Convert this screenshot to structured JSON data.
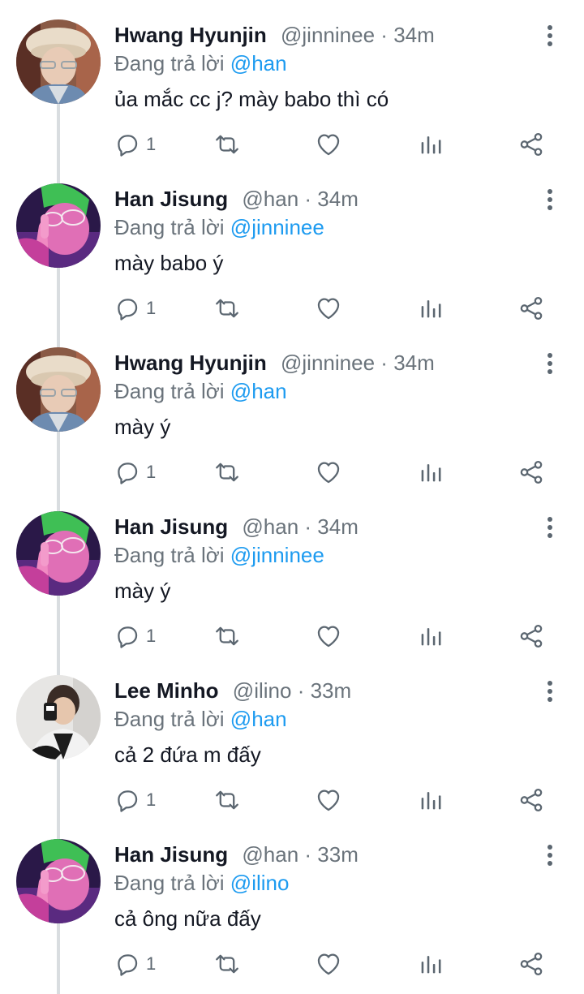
{
  "tweets": [
    {
      "display_name": "Hwang Hyunjin",
      "handle": "@jinninee",
      "separator": "·",
      "time": "34m",
      "reply_prefix": "Đang trả lời",
      "reply_to": "@han",
      "text": "ủa mắc cc j? mày babo thì có",
      "reply_count": "1",
      "avatar": "hyunjin-avatar"
    },
    {
      "display_name": "Han Jisung",
      "handle": "@han",
      "separator": "·",
      "time": "34m",
      "reply_prefix": "Đang trả lời",
      "reply_to": "@jinninee",
      "text": "mày babo ý",
      "reply_count": "1",
      "avatar": "jisung-avatar"
    },
    {
      "display_name": "Hwang Hyunjin",
      "handle": "@jinninee",
      "separator": "·",
      "time": "34m",
      "reply_prefix": "Đang trả lời",
      "reply_to": "@han",
      "text": "mày ý",
      "reply_count": "1",
      "avatar": "hyunjin-avatar"
    },
    {
      "display_name": "Han Jisung",
      "handle": "@han",
      "separator": "·",
      "time": "34m",
      "reply_prefix": "Đang trả lời",
      "reply_to": "@jinninee",
      "text": "mày ý",
      "reply_count": "1",
      "avatar": "jisung-avatar"
    },
    {
      "display_name": "Lee Minho",
      "handle": "@ilino",
      "separator": "·",
      "time": "33m",
      "reply_prefix": "Đang trả lời",
      "reply_to": "@han",
      "text": "cả 2 đứa m đấy",
      "reply_count": "1",
      "avatar": "minho-avatar"
    },
    {
      "display_name": "Han Jisung",
      "handle": "@han",
      "separator": "·",
      "time": "33m",
      "reply_prefix": "Đang trả lời",
      "reply_to": "@ilino",
      "text": "cả ông nữa đấy",
      "reply_count": "1",
      "avatar": "jisung-avatar"
    }
  ],
  "icons": {
    "reply": "reply-icon",
    "retweet": "retweet-icon",
    "like": "heart-icon",
    "analytics": "analytics-icon",
    "share": "share-icon",
    "more": "more-vertical-icon"
  },
  "colors": {
    "link": "#1d9bf0",
    "secondary_text": "#6a737b",
    "icon": "#5b6670",
    "thread_line": "#d9dde0"
  }
}
